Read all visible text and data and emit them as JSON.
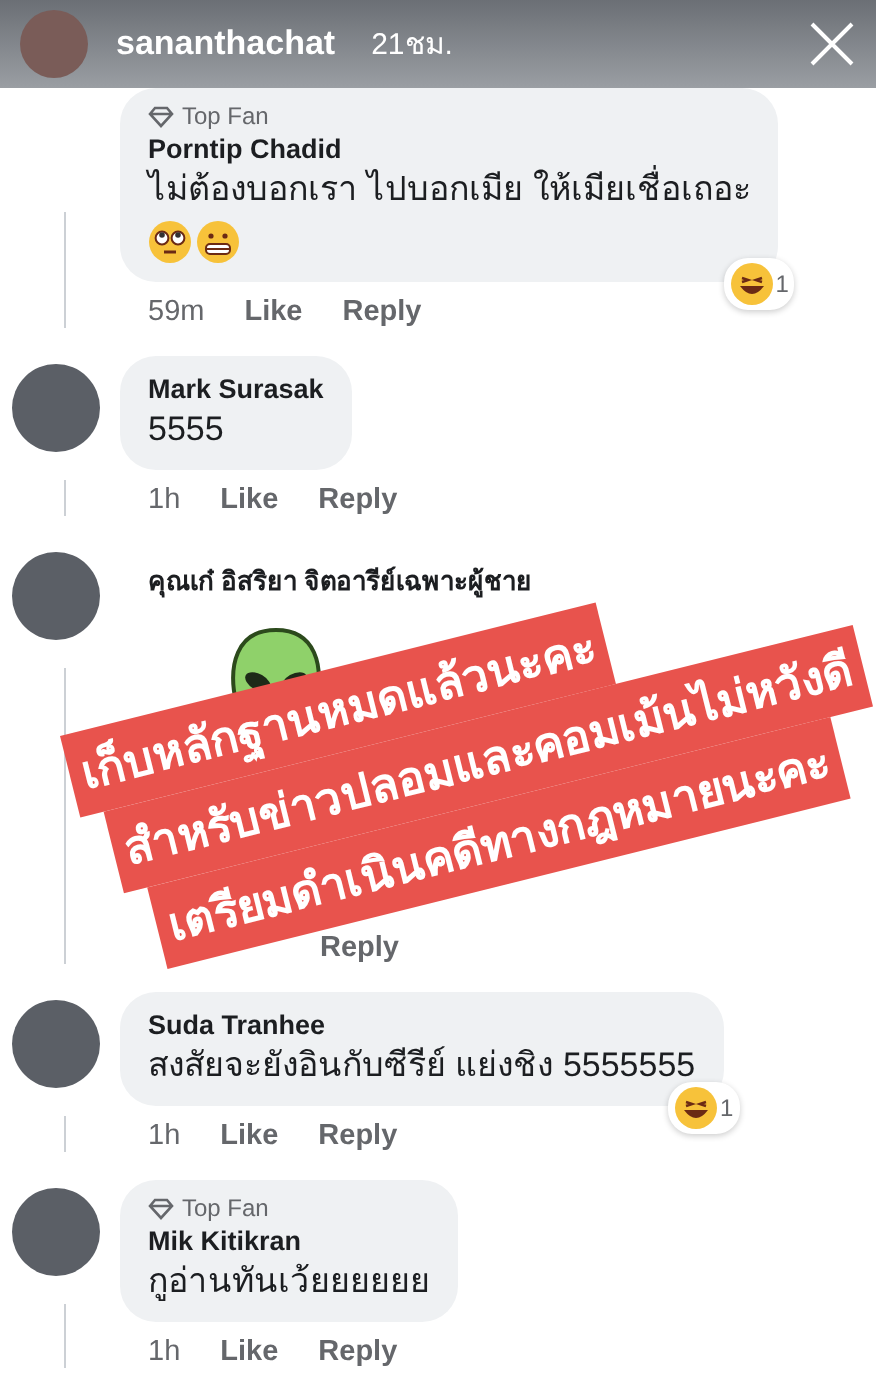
{
  "story": {
    "username": "sananthachat",
    "time": "21ชม."
  },
  "comments": [
    {
      "badge": "Top Fan",
      "name": "Porntip Chadid",
      "text": "ไม่ต้องบอกเรา ไปบอกเมีย ให้เมียเชื่อเถอะ",
      "kind": "text_emoji",
      "time": "59m",
      "like": "Like",
      "reply": "Reply",
      "reactions": "1"
    },
    {
      "name": "Mark Surasak",
      "text": "5555",
      "kind": "text",
      "time": "1h",
      "like": "Like",
      "reply": "Reply"
    },
    {
      "name": "คุณเก๋ อิสริยา จิตอารีย์เฉพาะผู้ชาย",
      "kind": "sticker",
      "reply": "Reply"
    },
    {
      "name": "Suda Tranhee",
      "text": "สงสัยจะยังอินกับซีรีย์ แย่งชิง 5555555",
      "kind": "text",
      "time": "1h",
      "like": "Like",
      "reply": "Reply",
      "reactions": "1"
    },
    {
      "badge": "Top Fan",
      "name": "Mik Kitikran",
      "text": "กูอ่านทันเว้ยยยยยย",
      "kind": "text",
      "time": "1h",
      "like": "Like",
      "reply": "Reply"
    }
  ],
  "banner": [
    "เก็บหลักฐานหมดแล้วนะคะ",
    "สำหรับข่าวปลอมและคอมเม้นไม่หวังดี",
    "เตรียมดำเนินคดีทางกฎหมายนะคะ"
  ]
}
